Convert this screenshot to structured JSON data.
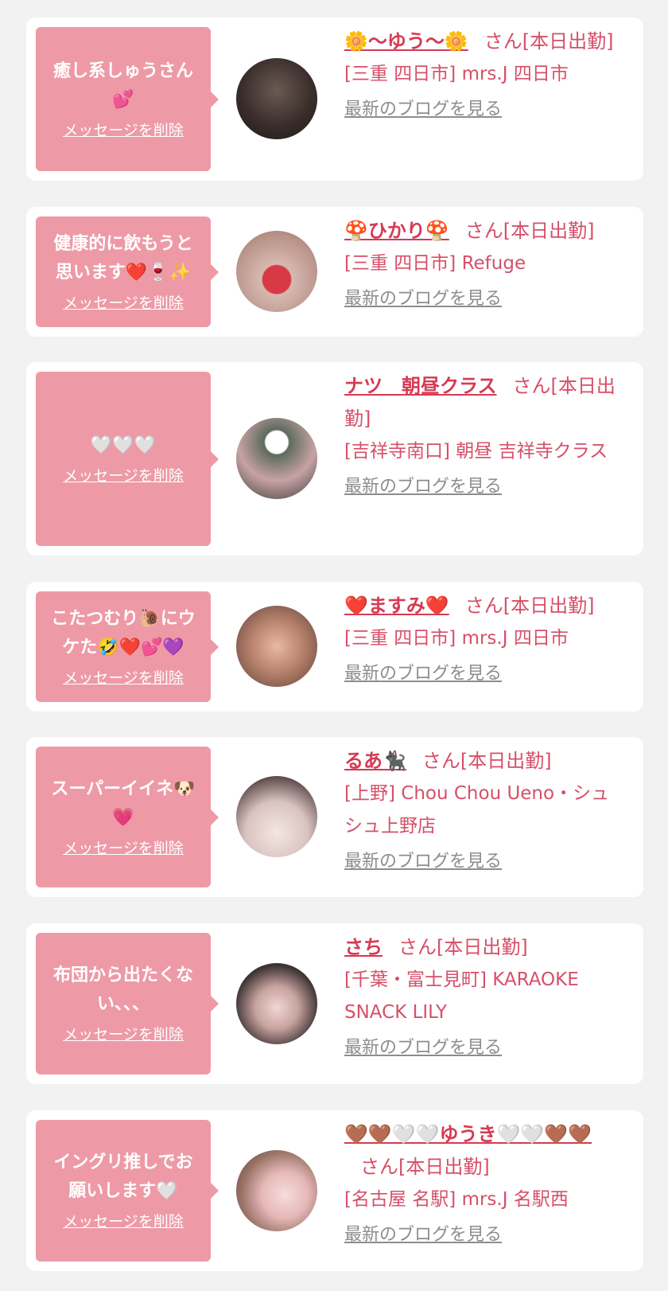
{
  "colors": {
    "background": "#f2f2f2",
    "card": "#ffffff",
    "bubble": "#ee9aa6",
    "accent_text": "#d64f69",
    "link_gray": "#8d8d8d"
  },
  "delete_label": "メッセージを削除",
  "blog_label": "最新のブログを見る",
  "items": [
    {
      "message": "癒し系しゅうさん\n💕",
      "name": "🌼〜ゆう〜🌼",
      "status": "さん[本日出勤]",
      "shop": "[三重 四日市] mrs.J 四日市"
    },
    {
      "message": "健康的に飲もうと\n思います❤️🍷✨",
      "name": "🍄ひかり🍄",
      "status": "さん[本日出勤]",
      "shop": "[三重 四日市] Refuge"
    },
    {
      "message": "🤍🤍🤍",
      "name": "ナツ　朝昼クラス",
      "status": "さん[本日出勤]",
      "shop": "[吉祥寺南口] 朝昼 吉祥寺クラス"
    },
    {
      "message": "こたつむり🐌にウ\nケた🤣❤️💕💜",
      "name": "❤️ますみ❤️",
      "status": "さん[本日出勤]",
      "shop": "[三重 四日市] mrs.J 四日市"
    },
    {
      "message": "スーパーイイネ🐶\n💗",
      "name": "るあ🐈‍⬛",
      "status": "さん[本日出勤]",
      "shop": "[上野] Chou Chou Ueno・シュシュ上野店"
    },
    {
      "message": "布団から出たくな\nい、、、",
      "name": "さち",
      "status": "さん[本日出勤]",
      "shop": "[千葉・富士見町] KARAOKE SNACK LILY"
    },
    {
      "message": "イングリ推しでお\n願いします🤍",
      "name": "🤎🤎🤍🤍ゆうき🤍🤍🤎🤎",
      "status": "さん[本日出勤]",
      "shop": "[名古屋 名駅] mrs.J 名駅西"
    }
  ]
}
